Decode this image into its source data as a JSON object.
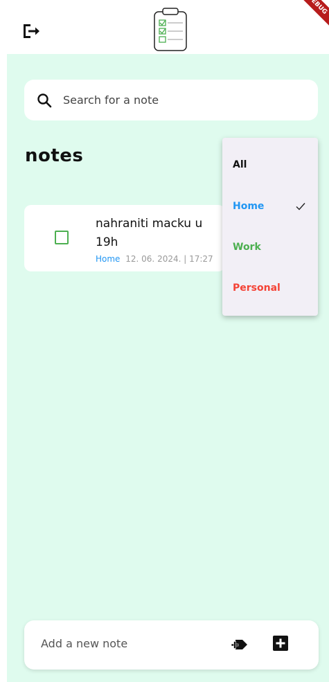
{
  "appbar": {
    "logout_icon": "logout-icon",
    "logo_icon": "clipboard-checklist-icon",
    "debug_banner": "DEBUG"
  },
  "search": {
    "icon": "search-icon",
    "placeholder": "Search for a note"
  },
  "page_title": "notes",
  "notes": [
    {
      "title": "nahraniti macku u 19h",
      "category": "Home",
      "date": "12. 06. 2024. | 17:27",
      "checked": false
    }
  ],
  "category_menu": {
    "items": [
      {
        "label": "All",
        "color": "#111111"
      },
      {
        "label": "Home",
        "color": "#2196f3",
        "selected": true
      },
      {
        "label": "Work",
        "color": "#4caf50"
      },
      {
        "label": "Personal",
        "color": "#f44336"
      }
    ]
  },
  "bottom_bar": {
    "placeholder": "Add a new note",
    "tag_icon": "add-tag-icon",
    "add_icon": "add-box-icon"
  },
  "colors": {
    "background": "#dffbee",
    "accent_green": "#4caf50",
    "accent_blue": "#2196f3",
    "accent_red": "#f44336"
  }
}
